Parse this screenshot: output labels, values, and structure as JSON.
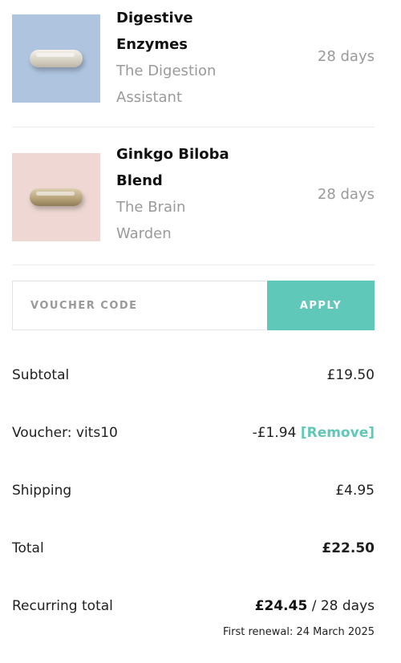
{
  "cart": {
    "items": [
      {
        "name_line1": "Digestive",
        "name_line2": "Enzymes",
        "subtitle_line1": "The Digestion",
        "subtitle_line2": "Assistant",
        "duration": "28 days",
        "thumb_color": "#aec4df"
      },
      {
        "name_line1": "Ginkgo Biloba",
        "name_line2": "Blend",
        "subtitle_line1": "The Brain",
        "subtitle_line2": "Warden",
        "duration": "28 days",
        "thumb_color": "#efd8d3"
      }
    ]
  },
  "voucher": {
    "placeholder": "VOUCHER CODE",
    "value": "",
    "apply_label": "APPLY",
    "accent_color": "#5fc8b8"
  },
  "totals": {
    "subtotal_label": "Subtotal",
    "subtotal_value": "£19.50",
    "voucher_label": "Voucher: vits10",
    "voucher_value": "-£1.94",
    "remove_label": "[Remove]",
    "shipping_label": "Shipping",
    "shipping_value": "£4.95",
    "total_label": "Total",
    "total_value": "£22.50",
    "recurring_label": "Recurring total",
    "recurring_value": "£24.45",
    "recurring_period": " / 28 days",
    "first_renewal": "First renewal: 24 March 2025"
  }
}
